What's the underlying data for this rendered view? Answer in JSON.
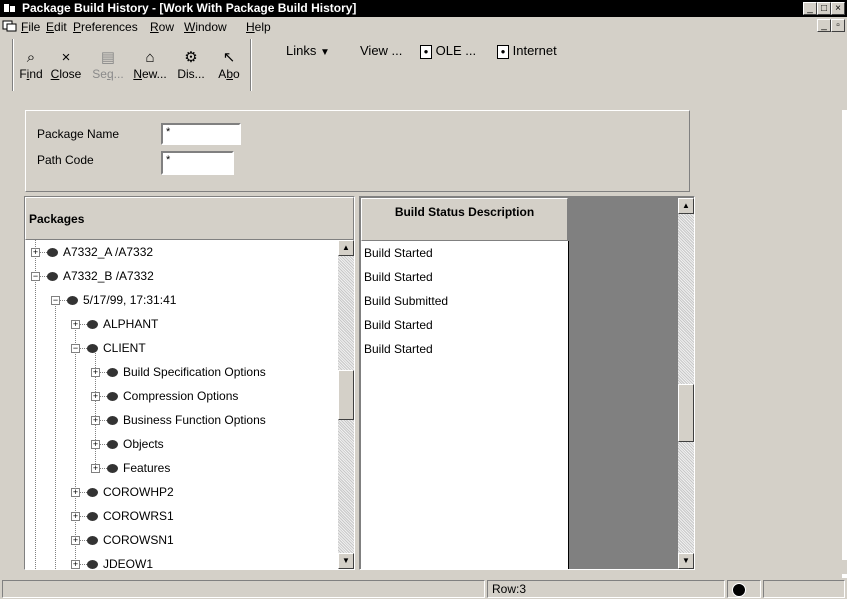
{
  "window": {
    "title": "Package Build History - [Work With Package Build History]"
  },
  "menu": [
    {
      "label": "File"
    },
    {
      "label": "Edit"
    },
    {
      "label": "Preferences"
    },
    {
      "label": "Row"
    },
    {
      "label": "Window"
    },
    {
      "label": "Help"
    }
  ],
  "toolbar": {
    "find": "Find",
    "close": "Close",
    "seq": "Seq...",
    "new": "New...",
    "dis": "Dis...",
    "abo": "Abo",
    "links": "Links",
    "view": "View ...",
    "ole": "OLE ...",
    "internet": "Internet"
  },
  "filter": {
    "package_name_label": "Package Name",
    "package_name_value": "*",
    "path_code_label": "Path Code",
    "path_code_value": "*"
  },
  "tree": {
    "header": "Packages",
    "items": [
      {
        "label": "A7332_A /A7332"
      },
      {
        "label": "A7332_B /A7332"
      },
      {
        "label": "5/17/99, 17:31:41"
      },
      {
        "label": "ALPHANT"
      },
      {
        "label": "CLIENT"
      },
      {
        "label": "Build Specification Options"
      },
      {
        "label": "Compression Options"
      },
      {
        "label": "Business Function Options"
      },
      {
        "label": "Objects"
      },
      {
        "label": "Features"
      },
      {
        "label": "COROWHP2"
      },
      {
        "label": "COROWRS1"
      },
      {
        "label": "COROWSN1"
      },
      {
        "label": "JDEOW1"
      }
    ]
  },
  "grid": {
    "column_header": "Build Status Description",
    "rows": [
      {
        "status": "Build Started"
      },
      {
        "status": "Build Started"
      },
      {
        "status": "Build Submitted"
      },
      {
        "status": "Build Started"
      },
      {
        "status": "Build Started"
      }
    ]
  },
  "status_bar": {
    "row_indicator": "Row:3"
  },
  "icons": {
    "tree_node": "package-icon",
    "colors": {
      "title_bar": "#000000",
      "panel_gray": "#808080",
      "face": "#d4d0c8"
    }
  }
}
